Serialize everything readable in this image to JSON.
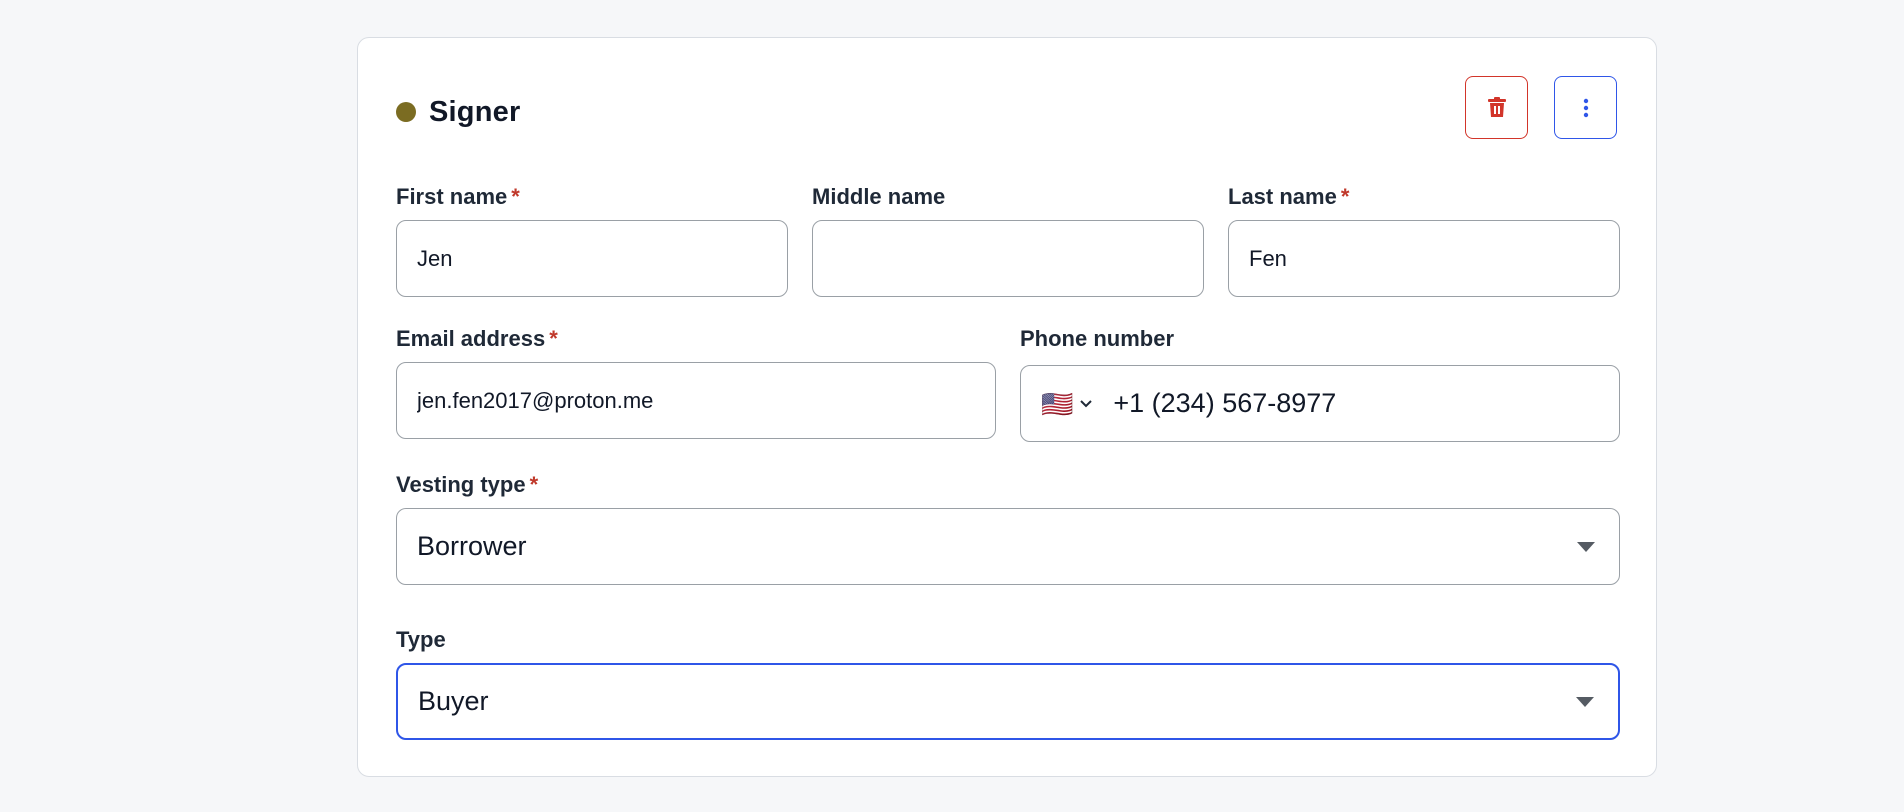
{
  "signer": {
    "title": "Signer",
    "dot_color": "#7b6c22",
    "actions": {
      "delete_icon": "trash-icon",
      "more_icon": "more-vertical-icon"
    }
  },
  "fields": {
    "first_name": {
      "label": "First name",
      "required_mark": "*",
      "value": "Jen"
    },
    "middle_name": {
      "label": "Middle name",
      "value": ""
    },
    "last_name": {
      "label": "Last name",
      "required_mark": "*",
      "value": "Fen"
    },
    "email": {
      "label": "Email address",
      "required_mark": "*",
      "value": "jen.fen2017@proton.me"
    },
    "phone": {
      "label": "Phone number",
      "country_flag": "🇺🇸",
      "value": "+1 (234) 567-8977"
    },
    "vesting_type": {
      "label": "Vesting type",
      "required_mark": "*",
      "value": "Borrower"
    },
    "type": {
      "label": "Type",
      "value": "Buyer"
    }
  },
  "colors": {
    "required": "#c0392b",
    "delete": "#d2352a",
    "accent": "#2f56e8"
  }
}
